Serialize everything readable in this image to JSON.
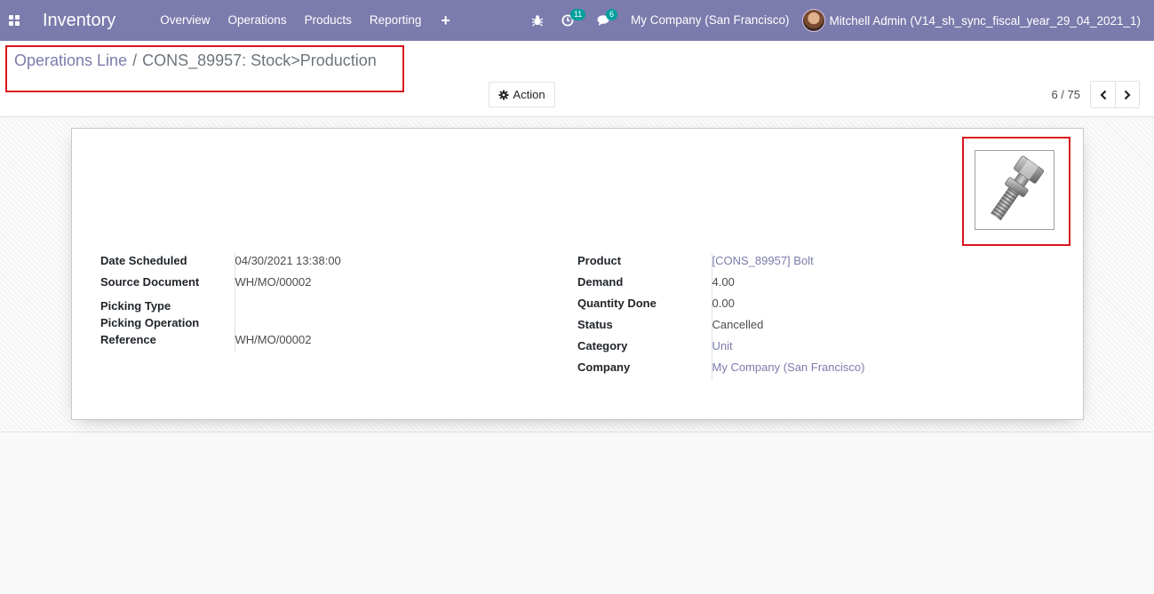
{
  "navbar": {
    "brand": "Inventory",
    "menu": [
      "Overview",
      "Operations",
      "Products",
      "Reporting"
    ],
    "plus": "+",
    "activity_count": "11",
    "message_count": "6",
    "company": "My Company (San Francisco)",
    "user": "Mitchell Admin (V14_sh_sync_fiscal_year_29_04_2021_1)"
  },
  "breadcrumb": {
    "parent": "Operations Line",
    "separator": "/",
    "current": "CONS_89957: Stock>Production"
  },
  "toolbar": {
    "action_label": "Action"
  },
  "pager": {
    "value": "6 / 75"
  },
  "form": {
    "left": {
      "date_scheduled_label": "Date Scheduled",
      "date_scheduled": "04/30/2021 13:38:00",
      "source_document_label": "Source Document",
      "source_document": "WH/MO/00002",
      "picking_type_label": "Picking Type",
      "picking_operation_reference_label_1": "Picking Operation",
      "picking_operation_reference_label_2": "Reference",
      "picking_operation_reference": "WH/MO/00002"
    },
    "right": {
      "product_label": "Product",
      "product": "[CONS_89957] Bolt",
      "demand_label": "Demand",
      "demand": "4.00",
      "quantity_done_label": "Quantity Done",
      "quantity_done": "0.00",
      "status_label": "Status",
      "status": "Cancelled",
      "category_label": "Category",
      "category": "Unit",
      "company_label": "Company",
      "company": "My Company (San Francisco)"
    }
  },
  "colors": {
    "navbar": "#7c7bad",
    "link": "#7c7bad",
    "highlight": "#d9161d",
    "badge": "#00a09d"
  },
  "icons": {
    "apps": "apps-grid-icon",
    "bug": "bug-icon",
    "activity": "clock-icon",
    "messages": "chat-icon",
    "gear": "gear-icon",
    "prev": "chevron-left-icon",
    "next": "chevron-right-icon"
  }
}
